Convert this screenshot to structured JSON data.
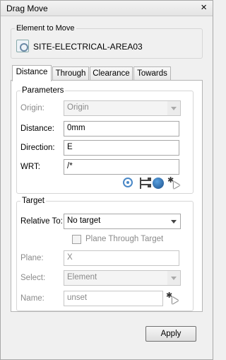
{
  "window": {
    "title": "Drag Move",
    "close": "×"
  },
  "element_group": {
    "label": "Element to Move",
    "icon": "element-icon",
    "value": "SITE-ELECTRICAL-AREA03"
  },
  "tabs": [
    {
      "label": "Distance",
      "active": true
    },
    {
      "label": "Through",
      "active": false
    },
    {
      "label": "Clearance",
      "active": false
    },
    {
      "label": "Towards",
      "active": false
    }
  ],
  "parameters": {
    "label": "Parameters",
    "origin": {
      "label": "Origin:",
      "value": "Origin"
    },
    "distance": {
      "label": "Distance:",
      "value": "0mm"
    },
    "direction": {
      "label": "Direction:",
      "value": "E"
    },
    "wrt": {
      "label": "WRT:",
      "value": "/*"
    },
    "tool_icons": [
      "locate-icon",
      "hierarchy-icon",
      "globe-icon",
      "pick-cursor-icon"
    ]
  },
  "target": {
    "label": "Target",
    "relative_to": {
      "label": "Relative To:",
      "value": "No target"
    },
    "plane_through_target": {
      "label": "Plane Through Target",
      "checked": false
    },
    "plane": {
      "label": "Plane:",
      "value": "X"
    },
    "select": {
      "label": "Select:",
      "value": "Element"
    },
    "name": {
      "label": "Name:",
      "value": "unset"
    }
  },
  "buttons": {
    "apply": "Apply"
  }
}
